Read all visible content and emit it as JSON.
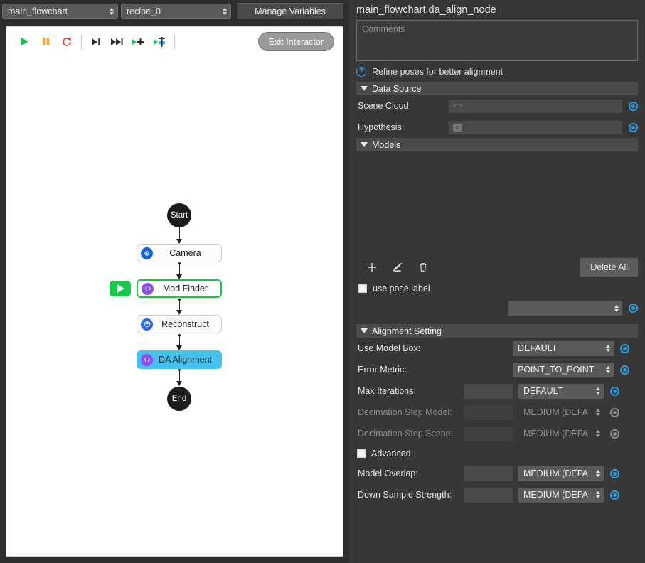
{
  "header": {
    "flowchart_select": "main_flowchart",
    "recipe_select": "recipe_0",
    "manage_variables_label": "Manage Variables"
  },
  "canvas_toolbar": {
    "exit_interactor_label": "Exit Interactor",
    "tools": [
      {
        "name": "run-icon",
        "title": "Run"
      },
      {
        "name": "pause-icon",
        "title": "Pause"
      },
      {
        "name": "reload-icon",
        "title": "Reload"
      },
      {
        "name": "step-over-icon",
        "title": "Step Over"
      },
      {
        "name": "step-forward-icon",
        "title": "Step Forward"
      },
      {
        "name": "run-to-node-icon",
        "title": "Run To Node"
      },
      {
        "name": "run-from-node-icon",
        "title": "Run From Node"
      }
    ]
  },
  "flowchart": {
    "start_label": "Start",
    "end_label": "End",
    "nodes": [
      {
        "label": "Camera",
        "icon": "camera-icon",
        "state": "normal"
      },
      {
        "label": "Mod Finder",
        "icon": "code-icon",
        "state": "highlight-green"
      },
      {
        "label": "Reconstruct",
        "icon": "cube-icon",
        "state": "normal"
      },
      {
        "label": "DA Alignment",
        "icon": "code-icon",
        "state": "selected-blue"
      }
    ],
    "run_badge_icon": "play-icon"
  },
  "inspector": {
    "node_title": "main_flowchart.da_align_node",
    "comments_placeholder": "Comments",
    "hint_icon": "question-icon",
    "hint_text": "Refine poses for better alignment",
    "data_source": {
      "title": "Data Source",
      "rows": [
        {
          "label": "Scene Cloud",
          "value": "",
          "field_icon": "link-icon"
        },
        {
          "label": "Hypothesis:",
          "value": "",
          "field_icon": "camera-icon"
        }
      ]
    },
    "models": {
      "title": "Models",
      "items": [],
      "tools": [
        {
          "name": "add-icon",
          "glyph": "+"
        },
        {
          "name": "edit-icon",
          "glyph": "pencil"
        },
        {
          "name": "delete-icon",
          "glyph": "trash"
        }
      ],
      "delete_all_label": "Delete All",
      "use_pose_label": "use pose label",
      "use_pose_checked": false,
      "pose_select_value": ""
    },
    "alignment": {
      "title": "Alignment Setting",
      "rows": [
        {
          "label": "Use Model Box:",
          "has_number": false,
          "number": "",
          "select": "DEFAULT",
          "disabled": false
        },
        {
          "label": "Error Metric:",
          "has_number": false,
          "number": "",
          "select": "POINT_TO_POINT",
          "disabled": false
        },
        {
          "label": "Max Iterations:",
          "has_number": true,
          "number": "",
          "select": "DEFAULT",
          "disabled": false
        },
        {
          "label": "Decimation Step Model:",
          "has_number": true,
          "number": "",
          "select": "MEDIUM (DEFA",
          "disabled": true
        },
        {
          "label": "Decimation Step Scene:",
          "has_number": true,
          "number": "",
          "select": "MEDIUM (DEFA",
          "disabled": true
        }
      ],
      "advanced_label": "Advanced",
      "advanced_checked": false,
      "rows2": [
        {
          "label": "Model Overlap:",
          "has_number": true,
          "number": "",
          "select": "MEDIUM (DEFA",
          "disabled": false
        },
        {
          "label": "Down Sample Strength:",
          "has_number": true,
          "number": "",
          "select": "MEDIUM (DEFA",
          "disabled": false
        }
      ]
    }
  },
  "colors": {
    "accent_blue": "#2d9de0",
    "highlight_green": "#12cc3a",
    "selected_blue": "#45c1ef",
    "panel_bg": "#373737",
    "canvas_bg": "#ffffff"
  }
}
